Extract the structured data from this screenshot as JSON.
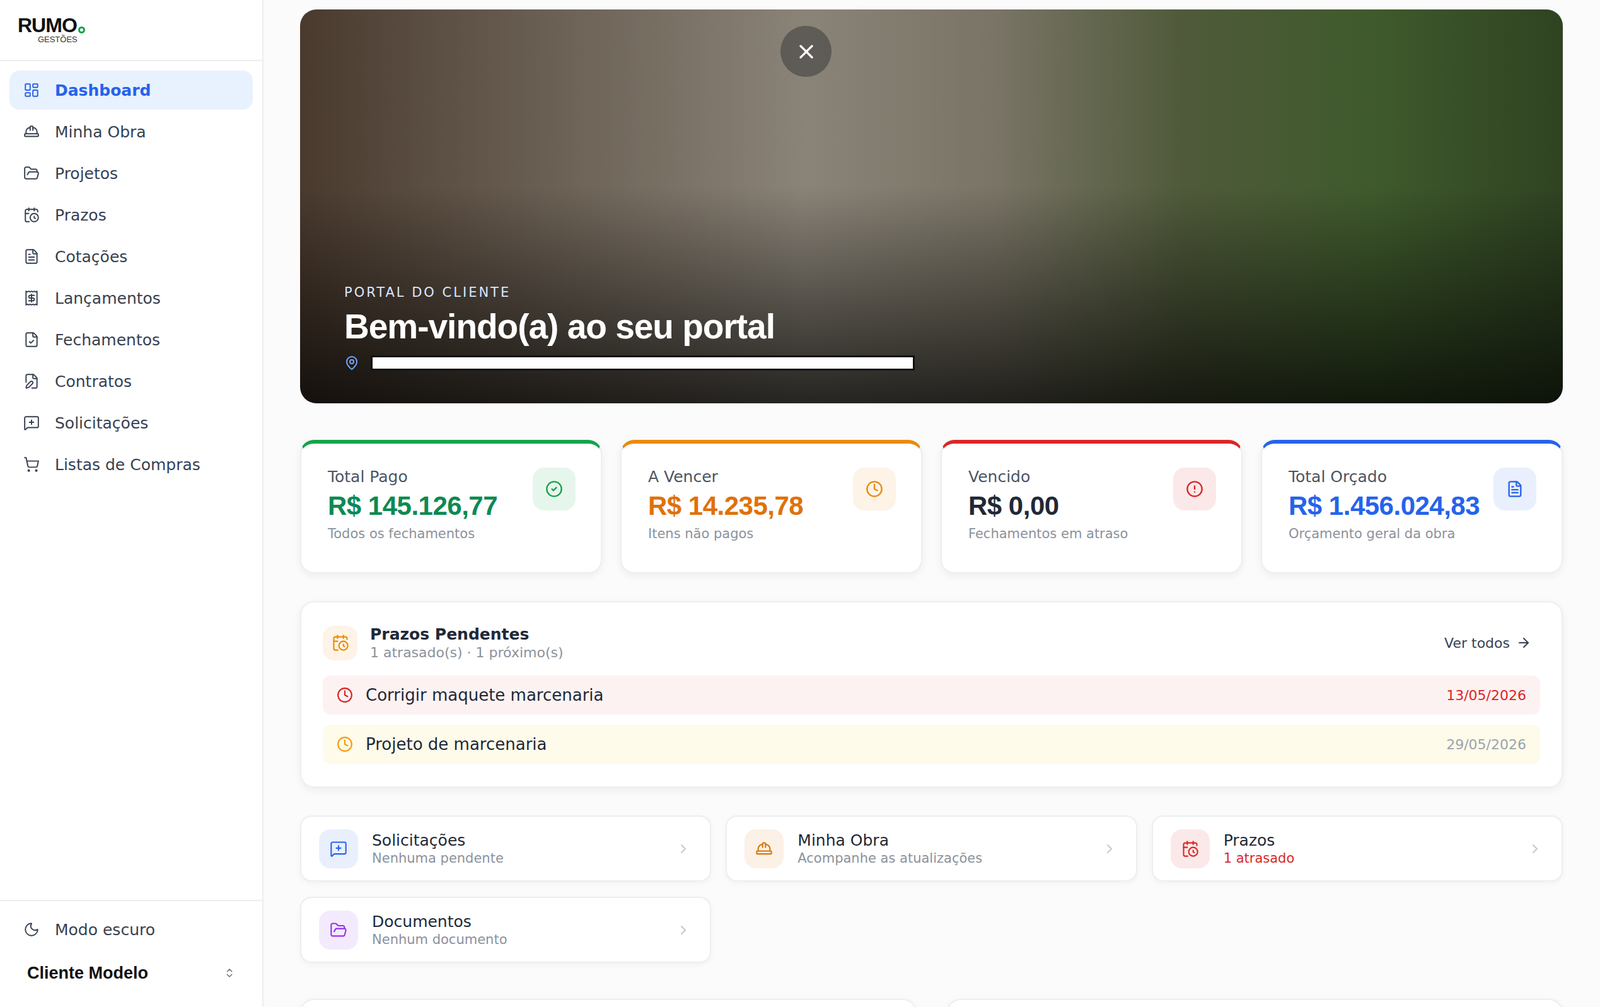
{
  "sidebar": {
    "logo": {
      "name": "RUMO",
      "tagline": "GESTÕES"
    },
    "items": [
      {
        "label": "Dashboard",
        "selected": true
      },
      {
        "label": "Minha Obra",
        "selected": false
      },
      {
        "label": "Projetos",
        "selected": false
      },
      {
        "label": "Prazos",
        "selected": false
      },
      {
        "label": "Cotações",
        "selected": false
      },
      {
        "label": "Lançamentos",
        "selected": false
      },
      {
        "label": "Fechamentos",
        "selected": false
      },
      {
        "label": "Contratos",
        "selected": false
      },
      {
        "label": "Solicitações",
        "selected": false
      },
      {
        "label": "Listas de Compras",
        "selected": false
      }
    ],
    "footer": {
      "theme_toggle": "Modo escuro",
      "user": "Cliente Modelo"
    }
  },
  "hero": {
    "eyebrow": "PORTAL DO CLIENTE",
    "title": "Bem-vindo(a) ao seu portal"
  },
  "stats": [
    {
      "label": "Total Pago",
      "value": "R$ 145.126,77",
      "note": "Todos os fechamentos",
      "color": "#16a34a",
      "value_color": "#0b8a52"
    },
    {
      "label": "A Vencer",
      "value": "R$ 14.235,78",
      "note": "Itens não pagos",
      "color": "#ea8a0c",
      "value_color": "#e0710a"
    },
    {
      "label": "Vencido",
      "value": "R$ 0,00",
      "note": "Fechamentos em atraso",
      "color": "#dc2626",
      "value_color": "#1f2937"
    },
    {
      "label": "Total Orçado",
      "value": "R$ 1.456.024,83",
      "note": "Orçamento geral da obra",
      "color": "#2563eb",
      "value_color": "#2563eb"
    }
  ],
  "deadlines": {
    "title": "Prazos Pendentes",
    "summary": "1 atrasado(s) · 1 próximo(s)",
    "link": "Ver todos",
    "items": [
      {
        "title": "Corrigir maquete marcenaria",
        "date": "13/05/2026",
        "overdue": true
      },
      {
        "title": "Projeto de marcenaria",
        "date": "29/05/2026",
        "overdue": false
      }
    ]
  },
  "shortcuts": [
    {
      "title": "Solicitações",
      "note": "Nenhuma pendente",
      "color": "#2563eb",
      "alert": false
    },
    {
      "title": "Minha Obra",
      "note": "Acompanhe as atualizações",
      "color": "#d97706",
      "alert": false
    },
    {
      "title": "Prazos",
      "note": "1 atrasado",
      "color": "#dc2626",
      "alert": true
    },
    {
      "title": "Documentos",
      "note": "Nenhum documento",
      "color": "#9333ea",
      "alert": false
    }
  ]
}
